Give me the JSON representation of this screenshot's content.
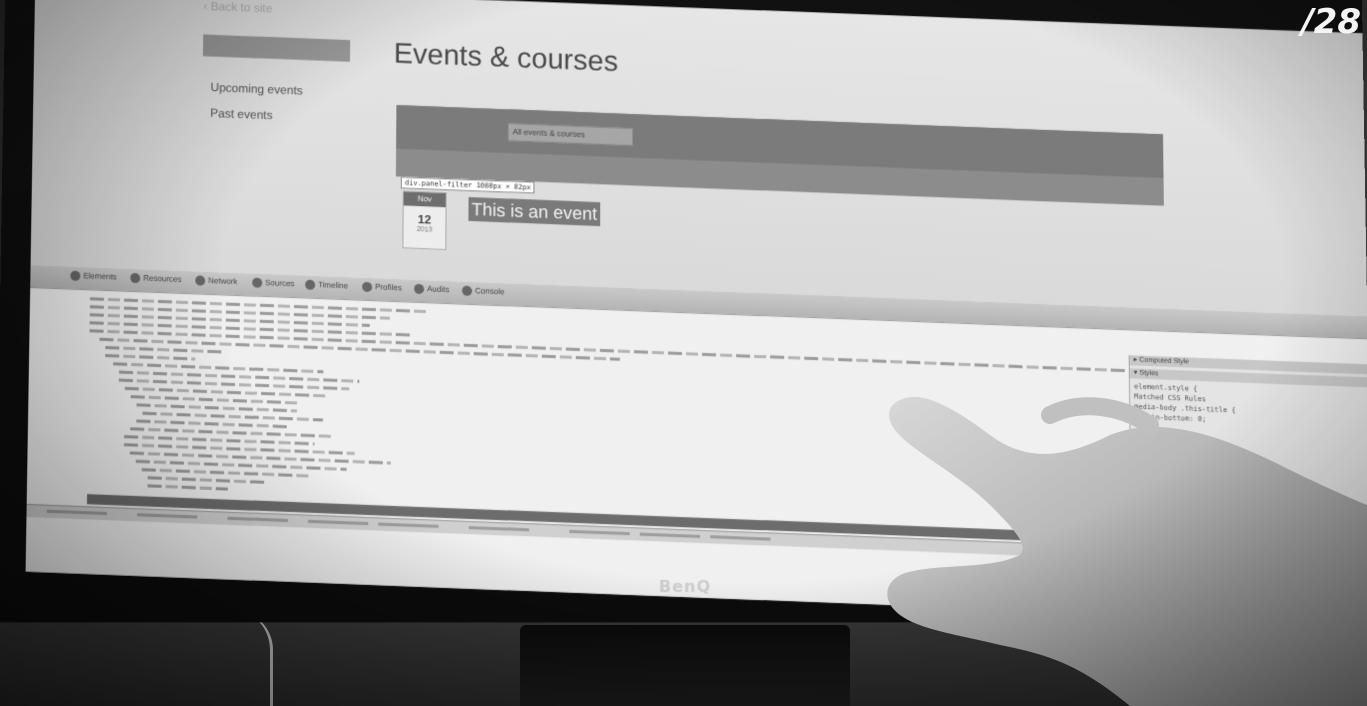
{
  "slide": {
    "counter": "/28"
  },
  "monitor": {
    "brand": "BenQ"
  },
  "page": {
    "back_link": "‹ Back to site",
    "sidebar": {
      "active": "Events & courses",
      "items": [
        {
          "label": "Upcoming events"
        },
        {
          "label": "Past events"
        }
      ]
    },
    "title": "Events & courses",
    "filter": {
      "select_label": "All events & courses"
    },
    "tooltip": "div.panel-filter 1088px × 82px",
    "event": {
      "month": "Nov",
      "day": "12",
      "year": "2013",
      "title": "This is an event"
    }
  },
  "devtools": {
    "tabs": [
      {
        "label": "Elements",
        "icon": "elements-icon"
      },
      {
        "label": "Resources",
        "icon": "resources-icon"
      },
      {
        "label": "Network",
        "icon": "network-icon"
      },
      {
        "label": "Sources",
        "icon": "sources-icon"
      },
      {
        "label": "Timeline",
        "icon": "timeline-icon"
      },
      {
        "label": "Profiles",
        "icon": "profiles-icon"
      },
      {
        "label": "Audits",
        "icon": "audits-icon"
      },
      {
        "label": "Console",
        "icon": "console-icon"
      }
    ],
    "right_panel": {
      "computed_header": "▸ Computed Style",
      "styles_header": "▾ Styles",
      "element_style": "element.style {",
      "media_header": "Matched CSS Rules",
      "rule": "media-body .this-title {",
      "prop": "margin-bottom: 0;"
    }
  }
}
